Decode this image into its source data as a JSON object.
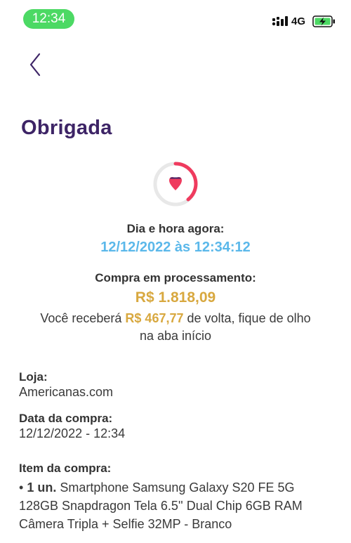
{
  "status_bar": {
    "time": "12:34",
    "network": "4G"
  },
  "header": {
    "title": "Obrigada"
  },
  "now": {
    "label": "Dia e hora agora:",
    "datetime": "12/12/2022 às 12:34:12"
  },
  "purchase": {
    "status_label": "Compra em processamento:",
    "amount": "R$ 1.818,09",
    "cashback_prefix": "Você receberá ",
    "cashback_amount": "R$ 467,77",
    "cashback_suffix_1": " de volta, fique de olho",
    "cashback_suffix_2": "na aba início"
  },
  "store": {
    "label": "Loja:",
    "value": "Americanas.com"
  },
  "purchase_date": {
    "label": "Data da compra:",
    "value": "12/12/2022 - 12:34"
  },
  "item": {
    "label": "Item da compra:",
    "bullet": "• ",
    "quantity": "1 un.",
    "description": " Smartphone Samsung Galaxy S20 FE 5G 128GB Snapdragon Tela 6.5'' Dual Chip 6GB RAM Câmera Tripla + Selfie 32MP - Branco"
  },
  "icons": {
    "back": "chevron-left-icon",
    "progress": "heart-progress-icon",
    "signal": "cellular-signal-icon",
    "battery": "battery-charging-icon"
  },
  "colors": {
    "title": "#3d2466",
    "accent_blue": "#5bb8ea",
    "accent_gold": "#d8a83f",
    "status_pill": "#4cd964",
    "heart": "#ef3b5e"
  }
}
